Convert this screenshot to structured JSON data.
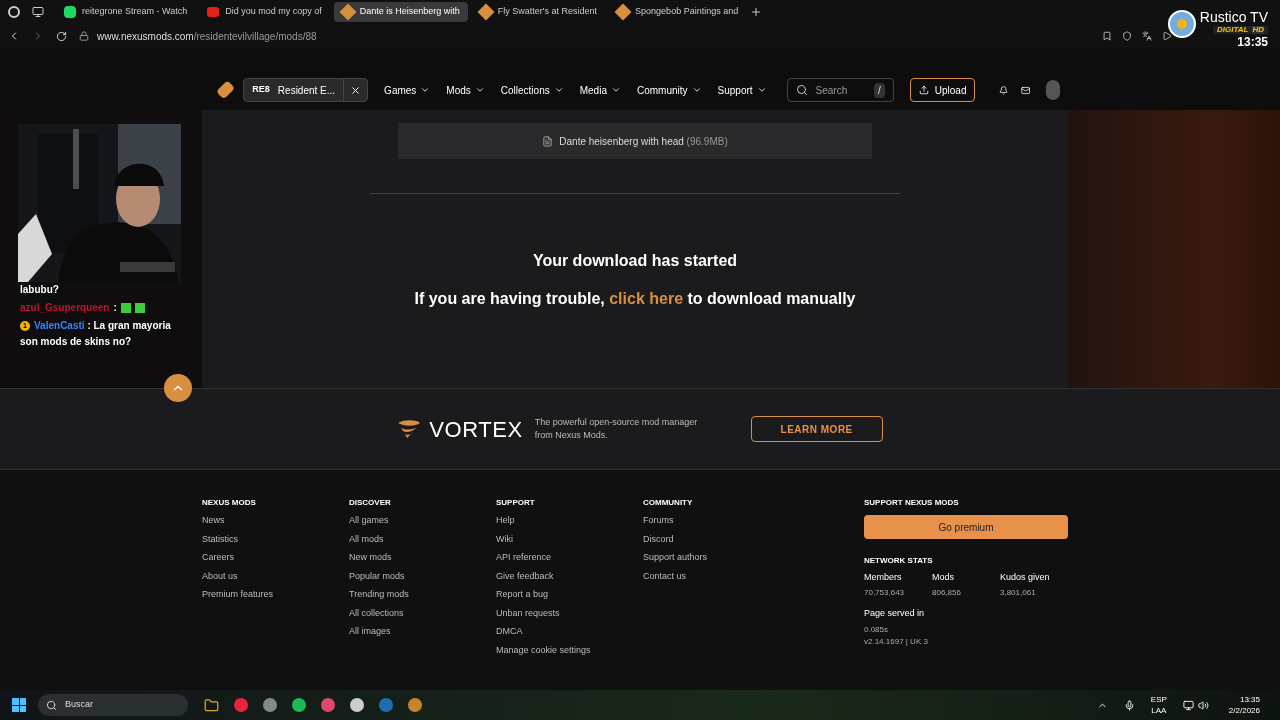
{
  "browser": {
    "tabs": [
      {
        "kind": "twitch",
        "title": "reitegrone Stream - Watch",
        "selected": false
      },
      {
        "kind": "youtube",
        "title": "Did you mod my copy of",
        "selected": false
      },
      {
        "kind": "nexus",
        "title": "Dante is Heisenberg with",
        "selected": true
      },
      {
        "kind": "nexus",
        "title": "Fly Swatter's at Resident",
        "selected": false
      },
      {
        "kind": "nexus",
        "title": "Spongebob Paintings and",
        "selected": false
      }
    ],
    "url_host": "www.nexusmods.com",
    "url_path": "/residentevilvillage/mods/88"
  },
  "stream": {
    "brand": "Rustico TV",
    "badge_left": "DIGITAL",
    "badge_right": "HD",
    "clock": "13:35",
    "chat": [
      {
        "kind": "text",
        "text": "labubu?"
      },
      {
        "kind": "emote",
        "user": "azul_Gsuperqueen",
        "color": "#c8102e",
        "separator": ":"
      },
      {
        "kind": "user",
        "badge": "1",
        "user": "ValenCasti",
        "color": "#3b82f6",
        "separator": ":",
        "text": "La gran mayoria son mods de skins no?"
      }
    ]
  },
  "nav": {
    "game_tag": "RE8",
    "game": "Resident E...",
    "items": [
      "Games",
      "Mods",
      "Collections",
      "Media",
      "Community",
      "Support"
    ],
    "search": {
      "placeholder": "Search",
      "shortcut": "/"
    },
    "upload": "Upload"
  },
  "download": {
    "file_name": "Dante heisenberg with head",
    "file_size": "(96.9MB)",
    "title": "Your download has started",
    "trouble_before": "If you are having trouble,",
    "trouble_link": "click here",
    "trouble_after": "to download manually"
  },
  "vortex": {
    "name": "VORTEX",
    "description": "The powerful open-source mod manager from Nexus Mods.",
    "button": "LEARN MORE"
  },
  "footer": {
    "columns": [
      {
        "heading": "NEXUS MODS",
        "links": [
          "News",
          "Statistics",
          "Careers",
          "About us",
          "Premium features"
        ]
      },
      {
        "heading": "DISCOVER",
        "links": [
          "All games",
          "All mods",
          "New mods",
          "Popular mods",
          "Trending mods",
          "All collections",
          "All images"
        ]
      },
      {
        "heading": "SUPPORT",
        "links": [
          "Help",
          "Wiki",
          "API reference",
          "Give feedback",
          "Report a bug",
          "Unban requests",
          "DMCA",
          "Manage cookie settings"
        ]
      },
      {
        "heading": "COMMUNITY",
        "links": [
          "Forums",
          "Discord",
          "Support authors",
          "Contact us"
        ]
      }
    ],
    "support_heading": "SUPPORT NEXUS MODS",
    "premium_button": "Go premium",
    "stats_heading": "NETWORK STATS",
    "stats": [
      {
        "label": "Members",
        "value": "70,753,643"
      },
      {
        "label": "Mods",
        "value": "806,856"
      },
      {
        "label": "Kudos given",
        "value": "3,801,061"
      }
    ],
    "served_label": "Page served in",
    "served_time": "0.085s",
    "version": "v2.14.1697 | UK 3"
  },
  "taskbar": {
    "search_placeholder": "Buscar",
    "lang_top": "ESP",
    "lang_bottom": "LAA",
    "time": "13:35",
    "date": "2/2/2026"
  }
}
